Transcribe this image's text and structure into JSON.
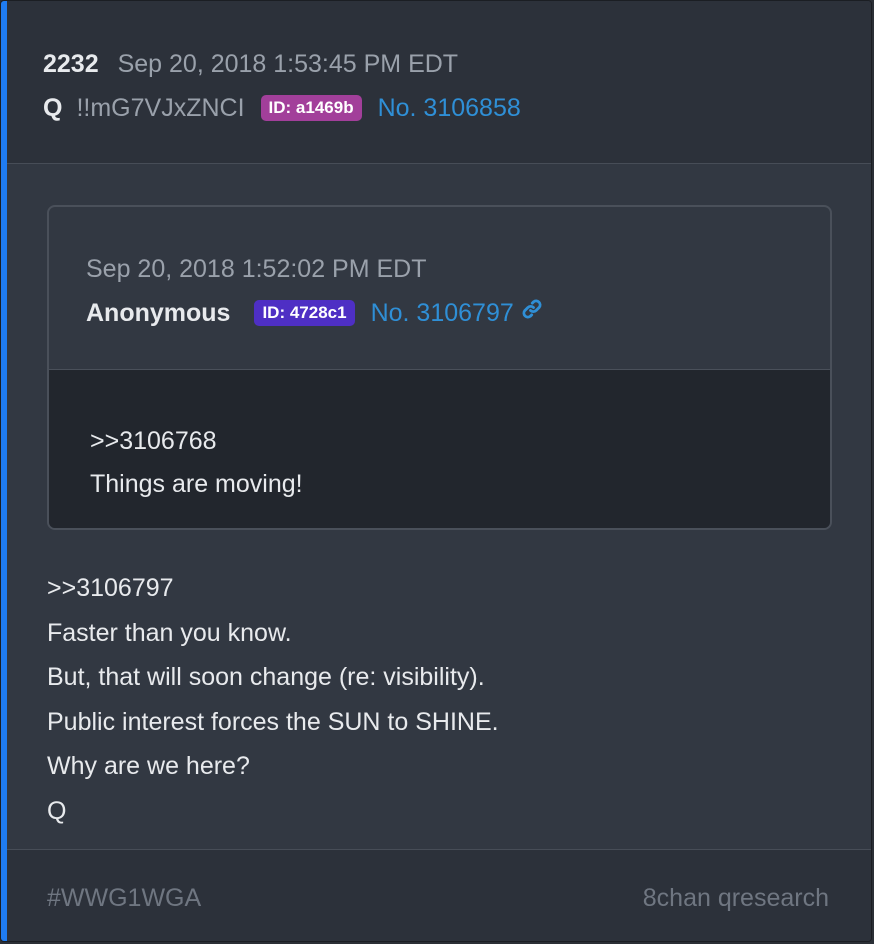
{
  "post": {
    "count": "2232",
    "timestamp": "Sep 20, 2018 1:53:45 PM EDT",
    "author": "Q",
    "tripcode": "!!mG7VJxZNCI",
    "id_badge": "ID: a1469b",
    "id_badge_color": "#a23f9a",
    "post_number": "No. 3106858",
    "body_lines": [
      ">>3106797",
      "Faster than you know.",
      "But, that will soon change (re: visibility).",
      "Public interest forces the SUN to SHINE.",
      "Why are we here?",
      "Q"
    ]
  },
  "quoted_post": {
    "timestamp": "Sep 20, 2018 1:52:02 PM EDT",
    "author": "Anonymous",
    "id_badge": "ID: 4728c1",
    "id_badge_color": "#4e2fc4",
    "post_number": "No. 3106797",
    "link_icon": "chain-link-icon",
    "body_lines": [
      ">>3106768",
      "Things are moving!"
    ]
  },
  "footer": {
    "hashtag": "#WWG1WGA",
    "source": "8chan qresearch"
  },
  "colors": {
    "accent": "#1f7cf2",
    "link": "#2f8fd6",
    "background": "#323842"
  }
}
